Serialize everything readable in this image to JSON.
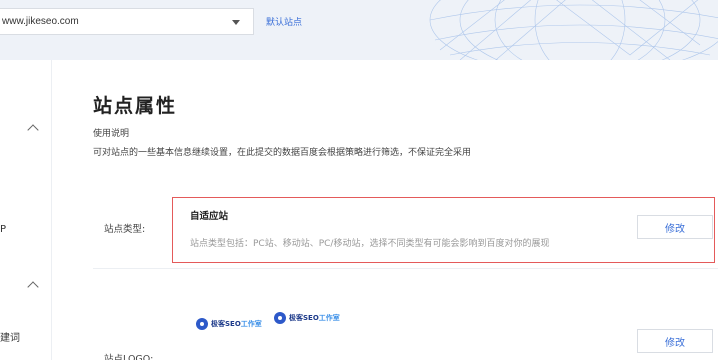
{
  "header": {
    "site_select_value": "www.jikeseo.com",
    "default_site_link": "默认站点"
  },
  "sidebar": {
    "partial_text_1": "P",
    "partial_text_2": "建词"
  },
  "page": {
    "title": "站点属性",
    "usage_label": "使用说明",
    "usage_desc": "可对站点的一些基本信息继续设置，在此提交的数据百度会根据策略进行筛选，不保证完全采用"
  },
  "site_type": {
    "label": "站点类型:",
    "value": "自适应站",
    "desc": "站点类型包括：PC站、移动站、PC/移动站，选择不同类型有可能会影响到百度对你的展现",
    "edit_label": "修改"
  },
  "site_logo": {
    "label": "站点LOGO:",
    "logo_text_main": "极客SEO",
    "logo_text_accent": "工作室",
    "edit_label": "修改"
  },
  "colors": {
    "accent": "#3a6fd8",
    "highlight_border": "#e45a5a",
    "header_bg": "#eef2f8"
  }
}
